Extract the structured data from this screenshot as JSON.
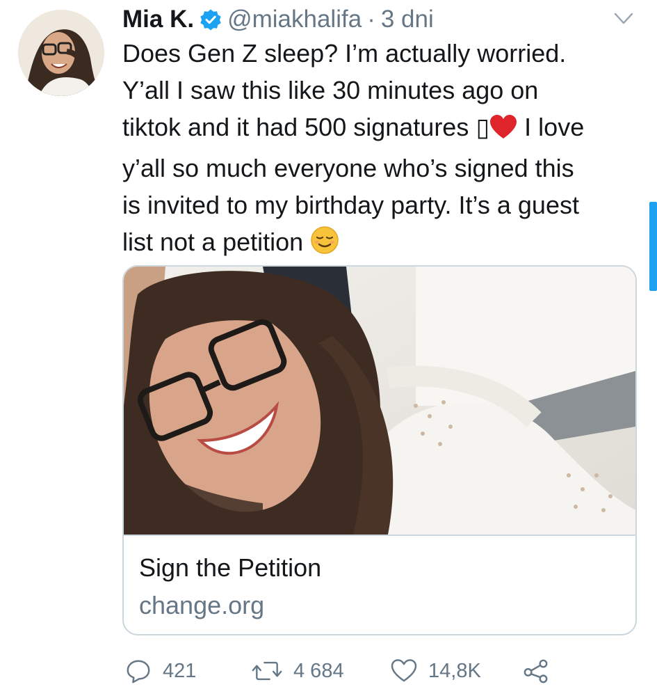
{
  "tweet": {
    "author_name": "Mia K.",
    "handle": "@miakhalifa",
    "separator": "·",
    "time": "3 dni",
    "text_lines": [
      "Does Gen Z sleep? I’m actually worried.",
      "Y’all I saw this like 30 minutes ago on",
      "tiktok and it had 500 signatures",
      "y’all so much everyone who’s signed this",
      "is invited to my birthday party. It’s a guest",
      "list not a petition"
    ],
    "line3_tail": "I love",
    "missing_glyph": "▯"
  },
  "card": {
    "title": "Sign the Petition",
    "domain": "change.org"
  },
  "actions": {
    "replies": "421",
    "retweets": "4 684",
    "likes": "14,8K"
  },
  "icons": {
    "verified": "verified-badge-icon",
    "chevron": "chevron-down-icon",
    "reply": "reply-icon",
    "retweet": "retweet-icon",
    "like": "heart-icon",
    "share": "share-icon",
    "heart_emoji": "red-heart-emoji",
    "relieved_emoji": "relieved-face-emoji"
  },
  "colors": {
    "verified_blue": "#1da1f2",
    "secondary_text": "#657786",
    "primary_text": "#14171a",
    "border": "#ccd6dd",
    "heart_red": "#e0242c",
    "emoji_yellow": "#f7c33b"
  }
}
